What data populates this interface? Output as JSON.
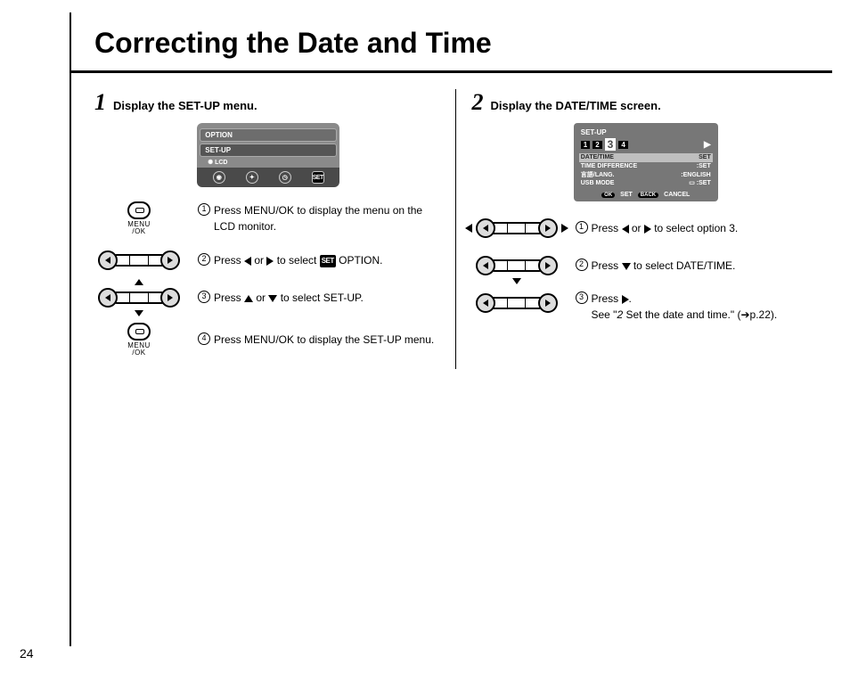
{
  "page_number": "24",
  "title": "Correcting the Date and Time",
  "col1": {
    "num": "1",
    "heading": "Display the SET-UP menu.",
    "screen": {
      "line1": "OPTION",
      "line2": "SET-UP",
      "line3": "LCD",
      "set_label": "SET"
    },
    "items": [
      {
        "n": "1",
        "ctrl": "menuok",
        "pre": "Press MENU/OK to display the menu on the LCD monitor."
      },
      {
        "n": "2",
        "ctrl": "dpad-h",
        "pre": "Press ",
        "mid": " or ",
        "post": " to select ",
        "post2": " OPTION.",
        "g1": "left",
        "g2": "right",
        "g3": "set"
      },
      {
        "n": "3",
        "ctrl": "dpad-v",
        "pre": "Press ",
        "mid": " or ",
        "post": " to select SET-UP.",
        "g1": "up",
        "g2": "down"
      },
      {
        "n": "4",
        "ctrl": "menuok",
        "pre": "Press MENU/OK to display the SET-UP menu."
      }
    ],
    "menuok_label_top": "MENU",
    "menuok_label_bot": "/OK"
  },
  "col2": {
    "num": "2",
    "heading": "Display the DATE/TIME screen.",
    "screen": {
      "header": "SET-UP",
      "tabs": [
        "1",
        "2",
        "3",
        "4"
      ],
      "rows": [
        {
          "l": "DATE/TIME",
          "r": "SET",
          "hl": true
        },
        {
          "l": "TIME DIFFERENCE",
          "r": ":SET"
        },
        {
          "l": "言語/LANG.",
          "r": ":ENGLISH"
        },
        {
          "l": "USB MODE",
          "r": ":SET"
        }
      ],
      "footer_set": "SET",
      "footer_cancel": "CANCEL",
      "footer_ok": "OK",
      "footer_back": "BACK"
    },
    "items": [
      {
        "n": "1",
        "ctrl": "dpad-out",
        "pre": "Press ",
        "mid": " or ",
        "post": " to select option 3.",
        "g1": "left",
        "g2": "right"
      },
      {
        "n": "2",
        "ctrl": "dpad-down",
        "pre": "Press ",
        "post": " to select DATE/TIME.",
        "g1": "down"
      },
      {
        "n": "3",
        "ctrl": "dpad-h",
        "pre": "Press ",
        "post": ".",
        "g1": "right",
        "extra1": "See \"",
        "extra_em": "2",
        "extra2": " Set the date and time.\" (➔p.22)."
      }
    ]
  }
}
